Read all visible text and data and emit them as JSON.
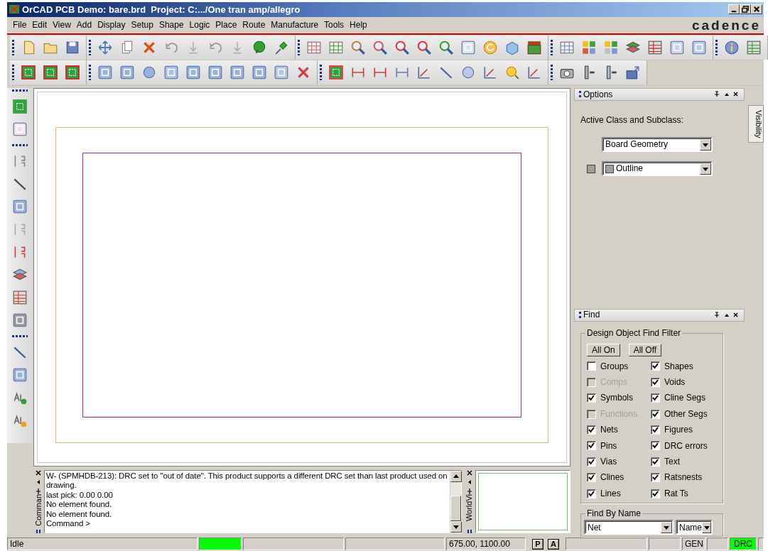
{
  "window": {
    "title": "OrCAD PCB Demo: bare.brd  Project: C:.../One tran amp/allegro"
  },
  "menu": [
    "File",
    "Edit",
    "View",
    "Add",
    "Display",
    "Setup",
    "Shape",
    "Logic",
    "Place",
    "Route",
    "Manufacture",
    "Tools",
    "Help"
  ],
  "logo": "cadence",
  "options": {
    "title": "Options",
    "label": "Active Class and Subclass:",
    "class_value": "Board Geometry",
    "subclass_value": "Outline"
  },
  "visibility_tab": {
    "label": "Visibility"
  },
  "find": {
    "title": "Find",
    "filter_title": "Design Object Find Filter",
    "buttons": [
      "All On",
      "All Off"
    ],
    "filters": [
      {
        "label": "Groups",
        "checked": false,
        "disabled": false
      },
      {
        "label": "Shapes",
        "checked": true,
        "disabled": false
      },
      {
        "label": "Comps",
        "checked": false,
        "disabled": true
      },
      {
        "label": "Voids",
        "checked": true,
        "disabled": false
      },
      {
        "label": "Symbols",
        "checked": true,
        "disabled": false
      },
      {
        "label": "Cline Segs",
        "checked": true,
        "disabled": false
      },
      {
        "label": "Functions",
        "checked": false,
        "disabled": true
      },
      {
        "label": "Other Segs",
        "checked": true,
        "disabled": false
      },
      {
        "label": "Nets",
        "checked": true,
        "disabled": false
      },
      {
        "label": "Figures",
        "checked": true,
        "disabled": false
      },
      {
        "label": "Pins",
        "checked": true,
        "disabled": false
      },
      {
        "label": "DRC errors",
        "checked": true,
        "disabled": false
      },
      {
        "label": "Vias",
        "checked": true,
        "disabled": false
      },
      {
        "label": "Text",
        "checked": true,
        "disabled": false
      },
      {
        "label": "Clines",
        "checked": true,
        "disabled": false
      },
      {
        "label": "Ratsnests",
        "checked": true,
        "disabled": false
      },
      {
        "label": "Lines",
        "checked": true,
        "disabled": false
      },
      {
        "label": "Rat Ts",
        "checked": true,
        "disabled": false
      }
    ],
    "by_name_title": "Find By Name",
    "object_value": "Net",
    "mode_value": "Name"
  },
  "command": {
    "tab_label": "Comman",
    "lines": [
      "W- (SPMHDB-213): DRC set to \"out of date\". This product supports a different DRC set than last product used on drawing.",
      "last pick:  0.00  0.00",
      "No element found.",
      "No element found.",
      "Command >"
    ]
  },
  "worldview": {
    "tab_label": "WorldVi"
  },
  "status_bar": {
    "fields": [
      {
        "kind": "text",
        "text": "Idle"
      },
      {
        "kind": "indicator",
        "color": "#00ff00"
      },
      {
        "kind": "blank"
      },
      {
        "kind": "blank"
      },
      {
        "kind": "text",
        "text": "675.00, 1100.00"
      },
      {
        "kind": "keys",
        "keys": [
          "P",
          "A"
        ]
      },
      {
        "kind": "blank"
      },
      {
        "kind": "blank"
      },
      {
        "kind": "text",
        "text": "GEN"
      },
      {
        "kind": "blank"
      },
      {
        "kind": "indicator",
        "color": "#00ff00",
        "text": "DRC"
      },
      {
        "kind": "blank"
      }
    ]
  }
}
